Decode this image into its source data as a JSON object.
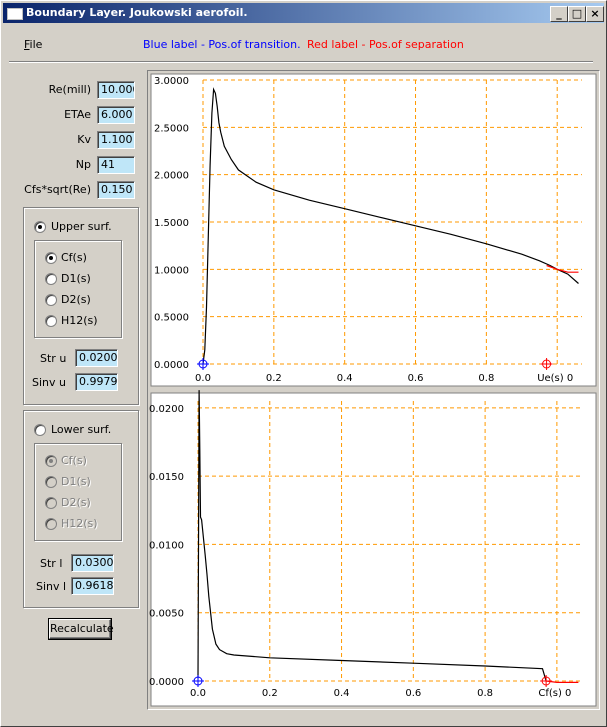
{
  "window": {
    "title": "Boundary Layer. Joukowski aerofoil.",
    "minimize": "_",
    "maximize": "□",
    "close": "×"
  },
  "menu": {
    "file_underlined": "F",
    "file_rest": "ile"
  },
  "legend": {
    "blue": "Blue label - Pos.of transition.",
    "red": "Red  label - Pos.of separation"
  },
  "params": [
    {
      "label": "Re(mill)",
      "value": "10.000"
    },
    {
      "label": "ETAe",
      "value": "6.000"
    },
    {
      "label": "Kv",
      "value": "1.100"
    },
    {
      "label": "Np",
      "value": "41"
    },
    {
      "label": "Cfs*sqrt(Re)",
      "value": "0.150"
    }
  ],
  "upper": {
    "label": "Upper surf.",
    "selected": true,
    "options": [
      "Cf(s)",
      "D1(s)",
      "D2(s)",
      "H12(s)"
    ],
    "selected_option": "Cf(s)",
    "str_label": "Str u",
    "str_value": "0.0200",
    "sinv_label": "Sinv u",
    "sinv_value": "0.9979"
  },
  "lower": {
    "label": "Lower surf.",
    "selected": false,
    "options": [
      "Cf(s)",
      "D1(s)",
      "D2(s)",
      "H12(s)"
    ],
    "selected_option": "Cf(s)",
    "str_label": "Str l",
    "str_value": "0.0300",
    "sinv_label": "Sinv l",
    "sinv_value": "0.9618"
  },
  "buttons": {
    "recalculate": "Recalculate"
  },
  "colors": {
    "grid": "#ff9900",
    "curve": "#000000",
    "transition": "#0000ff",
    "separation": "#ff0000"
  },
  "chart_data": [
    {
      "type": "line",
      "xlabel": "Ue(s)",
      "xticks": [
        "0.0",
        "0.2",
        "0.4",
        "0.6",
        "0.8",
        "1.0"
      ],
      "yticks": [
        "0.0000",
        "0.5000",
        "1.0000",
        "1.5000",
        "2.0000",
        "2.5000",
        "3.0000"
      ],
      "xlim": [
        0,
        1.07
      ],
      "ylim": [
        0,
        3.0
      ],
      "grid": true,
      "series": [
        {
          "values_x": [
            0,
            0.005,
            0.01,
            0.015,
            0.02,
            0.025,
            0.03,
            0.035,
            0.04,
            0.045,
            0.05,
            0.06,
            0.08,
            0.1,
            0.15,
            0.2,
            0.3,
            0.4,
            0.5,
            0.6,
            0.7,
            0.8,
            0.9,
            0.95,
            0.98,
            1.0,
            1.03,
            1.06
          ],
          "values_y": [
            0,
            0.15,
            0.6,
            1.35,
            2.1,
            2.65,
            2.9,
            2.86,
            2.72,
            2.55,
            2.45,
            2.3,
            2.16,
            2.05,
            1.92,
            1.84,
            1.73,
            1.64,
            1.55,
            1.46,
            1.37,
            1.27,
            1.16,
            1.09,
            1.04,
            1.0,
            0.95,
            0.85
          ]
        },
        {
          "values_x": [
            0.97,
            1.0,
            1.03,
            1.06
          ],
          "values_y": [
            1.04,
            1.0,
            0.97,
            0.97
          ],
          "color": "red"
        }
      ],
      "transition_x": 0.0,
      "separation_x": 0.97
    },
    {
      "type": "line",
      "xlabel": "Cf(s)",
      "xticks": [
        "0.0",
        "0.2",
        "0.4",
        "0.6",
        "0.8",
        "1.0"
      ],
      "yticks": [
        "0.0000",
        "0.0050",
        "0.0100",
        "0.0150",
        "0.0200"
      ],
      "xlim": [
        0,
        1.07
      ],
      "ylim": [
        0,
        0.0205
      ],
      "grid": true,
      "series": [
        {
          "values_x": [
            0,
            0.003,
            0.005,
            0.007,
            0.01,
            0.015,
            0.02,
            0.025,
            0.03,
            0.035,
            0.04,
            0.05,
            0.06,
            0.08,
            0.1,
            0.2,
            0.4,
            0.6,
            0.8,
            0.96,
            0.97
          ],
          "values_y": [
            0.0002,
            0.0213,
            0.017,
            0.012,
            0.0118,
            0.0105,
            0.0092,
            0.0078,
            0.0062,
            0.005,
            0.0038,
            0.0027,
            0.0023,
            0.002,
            0.0019,
            0.0017,
            0.0015,
            0.0013,
            0.0011,
            0.0009,
            0.0
          ]
        },
        {
          "values_x": [
            0.97,
            1.0,
            1.03,
            1.06
          ],
          "values_y": [
            0.0,
            -0.0001,
            -0.0001,
            -0.0001
          ],
          "color": "red"
        }
      ],
      "transition_x": 0.0,
      "separation_x": 0.97
    }
  ]
}
